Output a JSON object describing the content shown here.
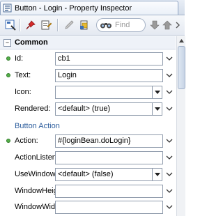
{
  "window": {
    "title": "Button - Login - Property Inspector"
  },
  "toolbar": {
    "search_placeholder": "Find"
  },
  "section": {
    "title": "Common",
    "collapse_glyph": "−"
  },
  "subsection": {
    "title": "Button Action"
  },
  "properties": {
    "id": {
      "label": "Id:",
      "value": "cb1"
    },
    "text": {
      "label": "Text:",
      "value": "Login"
    },
    "icon": {
      "label": "Icon:",
      "value": ""
    },
    "rendered": {
      "label": "Rendered:",
      "value": "<default> (true)"
    },
    "action": {
      "label": "Action:",
      "value": "#{loginBean.doLogin}"
    },
    "action_listener": {
      "label": "ActionListener:",
      "value": ""
    },
    "use_window": {
      "label": "UseWindow:",
      "value": "<default> (false)"
    },
    "window_height": {
      "label": "WindowHeight:",
      "value": ""
    },
    "window_width": {
      "label": "WindowWidth:",
      "value": ""
    }
  }
}
